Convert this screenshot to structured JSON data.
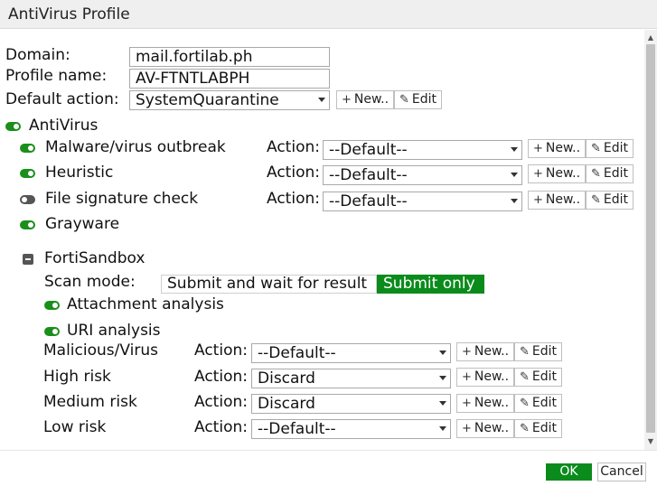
{
  "window": {
    "title": "AntiVirus Profile"
  },
  "profile": {
    "domain_label": "Domain:",
    "domain_value": "mail.fortilab.ph",
    "name_label": "Profile name:",
    "name_value": "AV-FTNTLABPH",
    "default_action_label": "Default action:",
    "default_action_value": "SystemQuarantine"
  },
  "buttons": {
    "new": "New..",
    "edit": "Edit",
    "ok": "OK",
    "cancel": "Cancel"
  },
  "antivirus": {
    "label": "AntiVirus",
    "enabled": true,
    "action_label": "Action:",
    "items": [
      {
        "label": "Malware/virus outbreak",
        "enabled": true,
        "action": "--Default--"
      },
      {
        "label": "Heuristic",
        "enabled": true,
        "action": "--Default--"
      },
      {
        "label": "File signature check",
        "enabled": false,
        "action": "--Default--"
      },
      {
        "label": "Grayware",
        "enabled": true
      }
    ]
  },
  "sandbox": {
    "label": "FortiSandbox",
    "scan_mode_label": "Scan mode:",
    "scan_modes": [
      "Submit and wait for result",
      "Submit only"
    ],
    "scan_mode_selected": "Submit only",
    "attachment_label": "Attachment analysis",
    "attachment_enabled": true,
    "uri_label": "URI analysis",
    "uri_enabled": true,
    "action_label": "Action:",
    "risks": [
      {
        "label": "Malicious/Virus",
        "action": "--Default--"
      },
      {
        "label": "High risk",
        "action": "Discard"
      },
      {
        "label": "Medium risk",
        "action": "Discard"
      },
      {
        "label": "Low risk",
        "action": "--Default--"
      }
    ]
  },
  "colors": {
    "accent_green": "#0b8b1c",
    "toggle_on": "#1a8f1a",
    "toggle_off": "#555555"
  }
}
